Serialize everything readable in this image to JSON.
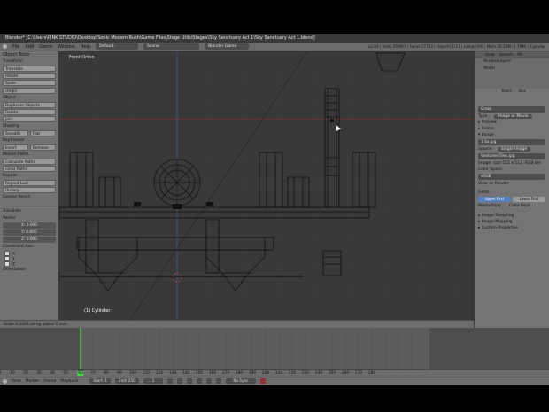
{
  "window": {
    "title": "Blender* [C:\\Users\\PINK STUDIO\\Desktop\\Sonic Modern Rush\\Game Files\\Stage Utils\\Stages\\Sky Sanctuary Act 1\\Sky Sanctuary Act 1.blend]"
  },
  "menubar": {
    "items": [
      "File",
      "Add",
      "Game",
      "Window",
      "Help"
    ],
    "layout": "Default",
    "scene": "Scene",
    "engine": "Blender Game",
    "stats": "v2.69 | Verts:2594/7 | Faces:17733 | Objects:1/11 | Lamps:0/0 | Mem:28.25M (1.79M) | Cylinder"
  },
  "tool_shelf": {
    "header": "Object Tools",
    "transform": {
      "label": "Transform",
      "buttons": [
        "Translate",
        "Rotate",
        "Scale"
      ],
      "origin": "Origin"
    },
    "object": {
      "label": "Object",
      "buttons": [
        "Duplicate Objects",
        "Delete",
        "Join"
      ]
    },
    "shading": {
      "label": "Shading",
      "smooth": "Smooth",
      "flat": "Flat"
    },
    "keyframes": {
      "label": "Keyframes",
      "insert": "Insert",
      "remove": "Remove"
    },
    "motion_paths": {
      "label": "Motion Paths",
      "buttons": [
        "Calculate Paths",
        "Clear Paths"
      ]
    },
    "repeat": {
      "label": "Repeat",
      "buttons": [
        "Repeat Last",
        "History..."
      ]
    },
    "grease_pencil": {
      "label": "Grease Pencil"
    },
    "translate_panel": {
      "header": "Translate",
      "vector_label": "Vector",
      "x": "X: 0.000",
      "y": "Y: 0.000",
      "z": "Z: 0.000",
      "constraint_label": "Constraint Axis",
      "axes": [
        "X",
        "Y",
        "Z"
      ],
      "orientation_label": "Orientation"
    }
  },
  "viewport": {
    "view_name": "Front Ortho",
    "object_label": "(1) Cylinder"
  },
  "redo_status": "Scale 0.2430 along global X axis",
  "outliner": {
    "header": [
      "View",
      "Search",
      "All"
    ],
    "items": [
      "RenderLayers",
      "World"
    ]
  },
  "properties": {
    "breadcrumb": [
      "Text3",
      "Gra"
    ],
    "image_name": "Grass",
    "type_label": "Type",
    "type_value": "Image or Movie",
    "preview": "Preview",
    "colors": "Colors",
    "image": "Image",
    "image_file": "1 Sa.jpg",
    "source_label": "Source",
    "source_value": "Single Image",
    "filepath": "\\textures\\Tiles.jpg",
    "image_info": "Image: size 512 x 512, RGB byt",
    "color_space_label": "Color Space",
    "color_space": "sRGB",
    "view_as_render": "View as Render",
    "fields": "Fields",
    "upper_first": "Upper First",
    "lower_first": "Lower First",
    "premultiply": "Premultiply",
    "color_unpremultiply": "Color Unpr",
    "image_sampling": "Image Sampling",
    "image_mapping": "Image Mapping",
    "custom_properties": "Custom Properties"
  },
  "timeline": {
    "ticks": [
      "0",
      "10",
      "20",
      "30",
      "40",
      "50",
      "60",
      "70",
      "80",
      "90",
      "100",
      "110",
      "120",
      "130",
      "140",
      "150",
      "160",
      "170",
      "180",
      "190",
      "200",
      "210",
      "220",
      "230",
      "240",
      "250",
      "260",
      "270",
      "280"
    ],
    "menu": [
      "View",
      "Marker",
      "Frame",
      "Playback"
    ],
    "start": "Start: 1",
    "end": "End: 250",
    "current": "1",
    "sync": "No Sync"
  },
  "colors": {
    "accent": "#5680c2",
    "grid_red": "#a03030",
    "wire": "#111111"
  }
}
